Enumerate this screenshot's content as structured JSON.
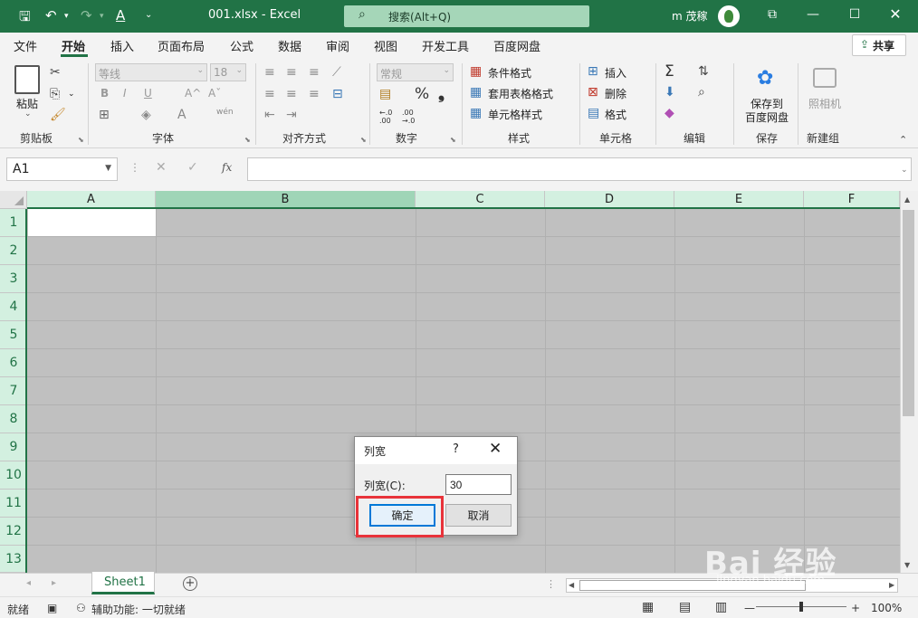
{
  "window": {
    "filename": "001.xlsx",
    "app": "Excel",
    "title_sep": "-",
    "search_placeholder": "搜索(Alt+Q)",
    "user": "m 茂稼",
    "share": "共享"
  },
  "menu": [
    "文件",
    "开始",
    "插入",
    "页面布局",
    "公式",
    "数据",
    "审阅",
    "视图",
    "开发工具",
    "百度网盘"
  ],
  "ribbon": {
    "clipboard": {
      "paste": "粘贴",
      "label": "剪贴板"
    },
    "font": {
      "name": "等线",
      "size": "18",
      "label": "字体",
      "bold": "B",
      "italic": "I",
      "underline": "U",
      "grow": "A^",
      "shrink": "Aˇ"
    },
    "alignment": {
      "label": "对齐方式"
    },
    "number": {
      "format": "常规",
      "label": "数字",
      "percent": "%",
      "comma": "❟",
      "inc": "←.0 .00",
      "dec": ".00 →.0"
    },
    "styles": {
      "conditional": "条件格式",
      "table": "套用表格格式",
      "cell": "单元格样式",
      "label": "样式"
    },
    "cells": {
      "insert": "插入",
      "delete": "删除",
      "format": "格式",
      "label": "单元格"
    },
    "editing": {
      "label": "编辑",
      "sum": "Σ"
    },
    "save": {
      "line1": "保存到",
      "line2": "百度网盘",
      "label": "保存"
    },
    "camera": {
      "text": "照相机",
      "label": "新建组"
    }
  },
  "namebox": "A1",
  "fx": "fx",
  "columns": [
    "A",
    "B",
    "C",
    "D",
    "E",
    "F"
  ],
  "rows": [
    "1",
    "2",
    "3",
    "4",
    "5",
    "6",
    "7",
    "8",
    "9",
    "10",
    "11",
    "12",
    "13"
  ],
  "sheet_tab": "Sheet1",
  "status": {
    "ready": "就绪",
    "accessibility": "辅助功能: 一切就绪",
    "zoom": "100%"
  },
  "dialog": {
    "title": "列宽",
    "help": "?",
    "label": "列宽(C):",
    "value": "30",
    "ok": "确定",
    "cancel": "取消"
  },
  "watermark": {
    "brand": "Bai 经验",
    "url": "jingyan.baidu.com"
  },
  "colors": {
    "accent": "#217346",
    "header": "#d3f0e0",
    "selected_header": "#9fd5b7",
    "highlight": "#e8333a"
  }
}
